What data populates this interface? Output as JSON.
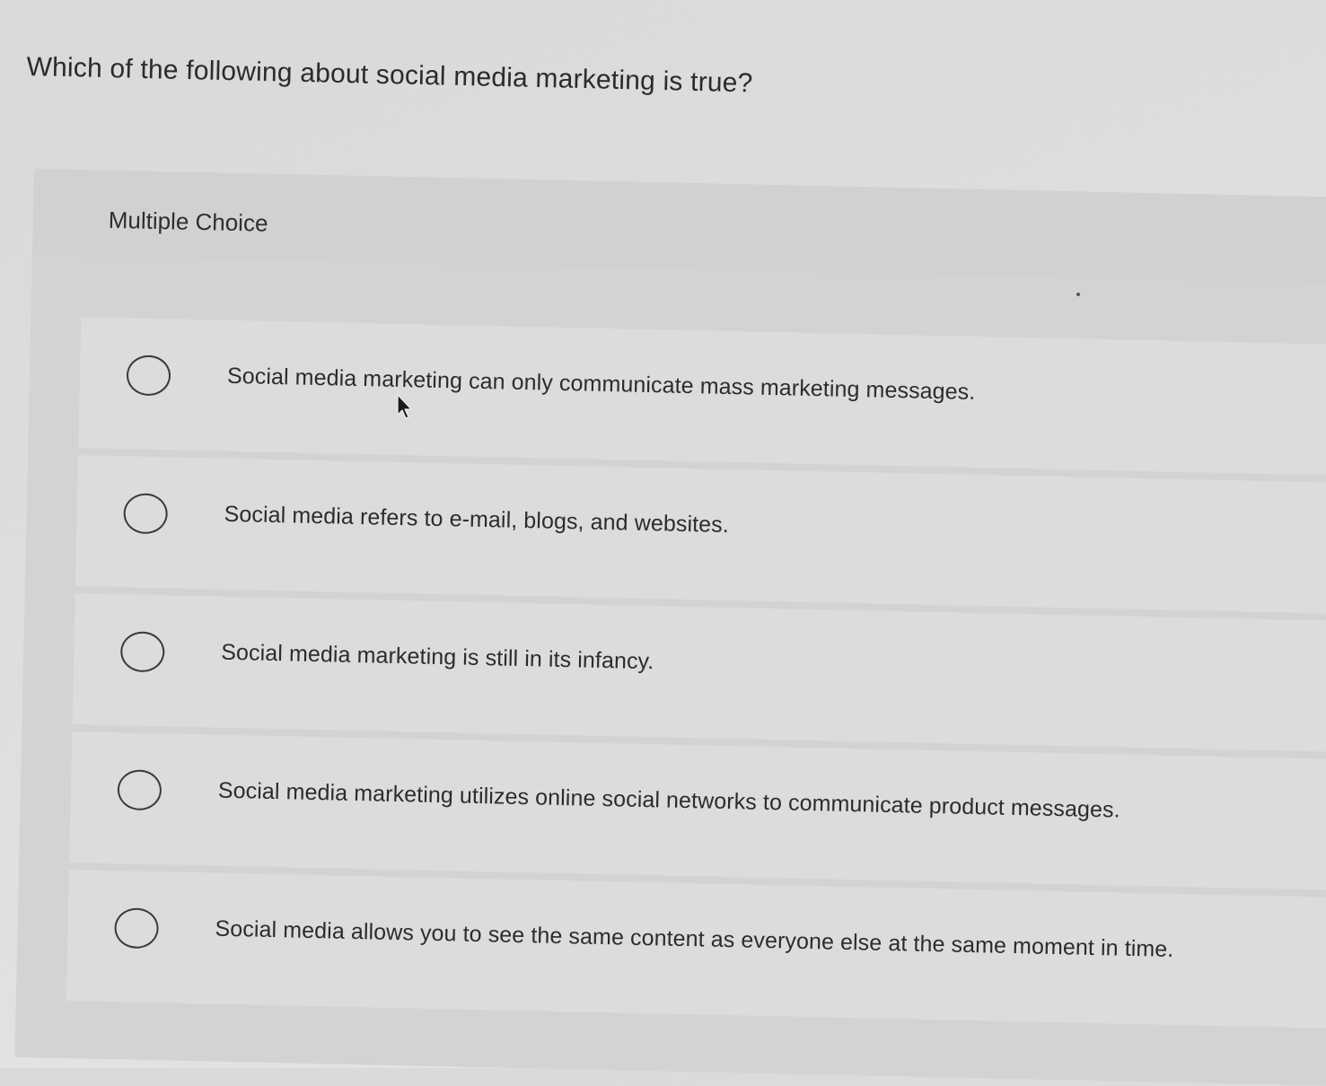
{
  "question": "Which of the following about social media marketing is true?",
  "question_type": "Multiple Choice",
  "options": [
    {
      "label": "Social media marketing can only communicate mass marketing messages."
    },
    {
      "label": "Social media refers to e-mail, blogs, and websites."
    },
    {
      "label": "Social media marketing is still in its infancy."
    },
    {
      "label": "Social media marketing utilizes online social networks to communicate product messages."
    },
    {
      "label": "Social media allows you to see the same content as everyone else at the same moment in time."
    }
  ],
  "icons": {
    "option_selector": "radio-unselected-icon",
    "pointer": "mouse-cursor-icon"
  },
  "colors": {
    "background": "#dedddb",
    "panel": "#d3d3d2",
    "option_row": "#dcdcdb",
    "text": "#2c2c2e"
  }
}
